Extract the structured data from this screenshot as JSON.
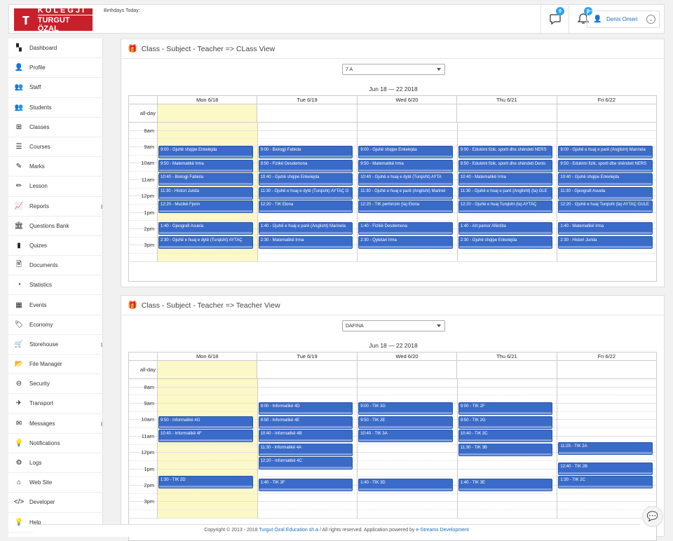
{
  "header": {
    "logo_top": "KOLEGJI",
    "logo_bottom": "TURGUT ÖZAL",
    "birthdays_label": "Birthdays Today:",
    "messages_badge": "0",
    "notifications_badge": "0",
    "user_name": "Denis Omeri"
  },
  "sidebar": {
    "items": [
      {
        "label": "Dashboard",
        "icon": "dashboard-icon",
        "glyph": "▚"
      },
      {
        "label": "Profile",
        "icon": "user-icon",
        "glyph": "👤"
      },
      {
        "label": "Staff",
        "icon": "staff-icon",
        "glyph": "👥"
      },
      {
        "label": "Students",
        "icon": "students-icon",
        "glyph": "👥"
      },
      {
        "label": "Classes",
        "icon": "classes-icon",
        "glyph": "⊞"
      },
      {
        "label": "Courses",
        "icon": "courses-icon",
        "glyph": "☰"
      },
      {
        "label": "Marks",
        "icon": "marks-icon",
        "glyph": "✎"
      },
      {
        "label": "Lesson",
        "icon": "lesson-icon",
        "glyph": "✏"
      },
      {
        "label": "Reports",
        "icon": "reports-icon",
        "glyph": "📈"
      },
      {
        "label": "Questions Bank",
        "icon": "bank-icon",
        "glyph": "🏛"
      },
      {
        "label": "Quizes",
        "icon": "quiz-icon",
        "glyph": "▮"
      },
      {
        "label": "Documents",
        "icon": "documents-icon",
        "glyph": "🖹"
      },
      {
        "label": "Statistics",
        "icon": "statistics-icon",
        "glyph": "◔"
      },
      {
        "label": "Events",
        "icon": "events-icon",
        "glyph": "▦"
      },
      {
        "label": "Economy",
        "icon": "economy-icon",
        "glyph": "🏷"
      },
      {
        "label": "Storehouse",
        "icon": "cart-icon",
        "glyph": "🛒"
      },
      {
        "label": "File Manager",
        "icon": "folder-icon",
        "glyph": "📂"
      },
      {
        "label": "Security",
        "icon": "security-icon",
        "glyph": "⊖"
      },
      {
        "label": "Transport",
        "icon": "plane-icon",
        "glyph": "✈"
      },
      {
        "label": "Messages",
        "icon": "envelope-icon",
        "glyph": "✉"
      },
      {
        "label": "Notifications",
        "icon": "bulb-icon",
        "glyph": "💡"
      },
      {
        "label": "Logs",
        "icon": "logs-icon",
        "glyph": "⚙"
      },
      {
        "label": "Web Site",
        "icon": "home-icon",
        "glyph": "⌂"
      },
      {
        "label": "Developer",
        "icon": "code-icon",
        "glyph": "</>"
      },
      {
        "label": "Help",
        "icon": "help-icon",
        "glyph": "💡"
      }
    ]
  },
  "calendar_common": {
    "days": [
      "Mon 6/18",
      "Tue 6/19",
      "Wed 6/20",
      "Thu 6/21",
      "Fri 6/22"
    ],
    "allday_label": "all-day",
    "hours": [
      "8am",
      "9am",
      "10am",
      "11am",
      "12pm",
      "1pm",
      "2pm",
      "3pm"
    ],
    "range": "Jun 18 — 22 2018"
  },
  "class_view": {
    "title": "Class - Subject - Teacher => CLass View",
    "select_value": "7 A",
    "events": [
      {
        "day": 0,
        "start": 9.0,
        "text": "9:00 - Gjuhë shqipe Enkelejda"
      },
      {
        "day": 0,
        "start": 9.833,
        "text": "9:50 - Matematikë Irma"
      },
      {
        "day": 0,
        "start": 10.667,
        "text": "10:40 - Biologji Fabiola"
      },
      {
        "day": 0,
        "start": 11.5,
        "text": "11:30 - Histori Jurida"
      },
      {
        "day": 0,
        "start": 12.333,
        "text": "12:20 - Muzikë Fjorin"
      },
      {
        "day": 0,
        "start": 13.667,
        "text": "1:40 - Gjeografi Asuela"
      },
      {
        "day": 0,
        "start": 14.5,
        "text": "2:30 - Gjuhë e huaj e dytë (Turqisht) AYTAÇ"
      },
      {
        "day": 1,
        "start": 9.0,
        "text": "9:00 - Biologji Fabiola"
      },
      {
        "day": 1,
        "start": 9.833,
        "text": "9:50 - Fizikë Desdemona"
      },
      {
        "day": 1,
        "start": 10.667,
        "text": "10:40 - Gjuhë shqipe Enkelejda"
      },
      {
        "day": 1,
        "start": 11.5,
        "text": "11:30 - Gjuhë e huaj e dytë (Turqisht) AYTAÇ G"
      },
      {
        "day": 1,
        "start": 12.333,
        "text": "12:20 - TIK Elona"
      },
      {
        "day": 1,
        "start": 13.667,
        "text": "1:40 - Gjuhë e huaj e parë (Anglisht) Marinela"
      },
      {
        "day": 1,
        "start": 14.5,
        "text": "2:30 - Matematikë Irma"
      },
      {
        "day": 2,
        "start": 9.0,
        "text": "9:00 - Gjuhë shqipe Enkelejda"
      },
      {
        "day": 2,
        "start": 9.833,
        "text": "9:50 - Matematikë Irma"
      },
      {
        "day": 2,
        "start": 10.667,
        "text": "10:40 - Gjuhë e huaj e dytë (Turqisht) AYTA"
      },
      {
        "day": 2,
        "start": 11.5,
        "text": "11:30 - Gjuhë e huaj e parë (Anglisht) Marinel"
      },
      {
        "day": 2,
        "start": 12.333,
        "text": "12:20 - TIK perforcim (ta) Elona"
      },
      {
        "day": 2,
        "start": 13.667,
        "text": "1:40 - Fizikë Desdemona"
      },
      {
        "day": 2,
        "start": 14.5,
        "text": "2:30 - Qytetari Irma"
      },
      {
        "day": 3,
        "start": 9.0,
        "text": "9:00 - Edukimi fizik, sporti dhe shëndeti NERS"
      },
      {
        "day": 3,
        "start": 9.833,
        "text": "9:50 - Edukimi fizik, sporti dhe shëndeti Denis"
      },
      {
        "day": 3,
        "start": 10.667,
        "text": "10:40 - Matematikë Irma"
      },
      {
        "day": 3,
        "start": 11.5,
        "text": "11:30 - Gjuhë e huaj e parë (Anglisht) (ta) GLE"
      },
      {
        "day": 3,
        "start": 12.333,
        "text": "12:20 - Gjuhë e huaj Turqisht (ta) AYTAÇ"
      },
      {
        "day": 3,
        "start": 13.667,
        "text": "1:40 - Art pamor Afërdita"
      },
      {
        "day": 3,
        "start": 14.5,
        "text": "2:30 - Gjuhë shqipe Enkelejda"
      },
      {
        "day": 4,
        "start": 9.0,
        "text": "9:00 - Gjuhë e huaj e parë (Anglisht) Marinela"
      },
      {
        "day": 4,
        "start": 9.833,
        "text": "9:50 - Edukimi fizik, sporti dhe shëndeti NERS"
      },
      {
        "day": 4,
        "start": 10.667,
        "text": "10:40 - Gjuhë shqipe Enkelejda"
      },
      {
        "day": 4,
        "start": 11.5,
        "text": "11:30 - Gjeografi Asuela"
      },
      {
        "day": 4,
        "start": 12.333,
        "text": "12:20 - Gjuhë e huaj Turqisht (ta) AYTAÇ GULE"
      },
      {
        "day": 4,
        "start": 13.667,
        "text": "1:40 - Matematikë Irma"
      },
      {
        "day": 4,
        "start": 14.5,
        "text": "2:30 - Histori Jurida"
      }
    ]
  },
  "teacher_view": {
    "title": "Class - Subject - Teacher => Teacher View",
    "select_value": "DAFINA",
    "events": [
      {
        "day": 0,
        "start": 9.833,
        "text": "9:50 - Informatikë 4G"
      },
      {
        "day": 0,
        "start": 10.667,
        "text": "10:40 - Informatikë 4F"
      },
      {
        "day": 0,
        "start": 13.5,
        "text": "1:30 - TIK 2D"
      },
      {
        "day": 1,
        "start": 9.0,
        "text": "9:00 - Informatikë 4D"
      },
      {
        "day": 1,
        "start": 9.833,
        "text": "9:50 - Informatikë 4E"
      },
      {
        "day": 1,
        "start": 10.667,
        "text": "10:40 - Informatikë 4B"
      },
      {
        "day": 1,
        "start": 11.5,
        "text": "11:30 - Informatikë 4A"
      },
      {
        "day": 1,
        "start": 12.333,
        "text": "12:20 - Informatikë 4C"
      },
      {
        "day": 1,
        "start": 13.667,
        "text": "1:40 - TIK 3F"
      },
      {
        "day": 2,
        "start": 9.0,
        "text": "9:00 - TIK 3G"
      },
      {
        "day": 2,
        "start": 9.833,
        "text": "9:50 - TIK 2E"
      },
      {
        "day": 2,
        "start": 10.667,
        "text": "10:40 - TIK 3A"
      },
      {
        "day": 2,
        "start": 13.667,
        "text": "1:40 - TIK 3D"
      },
      {
        "day": 3,
        "start": 9.0,
        "text": "9:00 - TIK 2F"
      },
      {
        "day": 3,
        "start": 9.833,
        "text": "9:50 - TIK 2G"
      },
      {
        "day": 3,
        "start": 10.667,
        "text": "10:40 - TIK 3C"
      },
      {
        "day": 3,
        "start": 11.5,
        "text": "11:30 - TIK 3B"
      },
      {
        "day": 3,
        "start": 13.667,
        "text": "1:40 - TIK 3E"
      },
      {
        "day": 4,
        "start": 11.417,
        "text": "11:25 - TIK 2A"
      },
      {
        "day": 4,
        "start": 12.667,
        "text": "12:40 - TIK 2B"
      },
      {
        "day": 4,
        "start": 13.5,
        "text": "1:30 - TIK 2C"
      }
    ]
  },
  "footer": {
    "prefix": "Copyright © 2013 - 2018",
    "company": "Turgut Özal Education sh.a",
    "middle": "/ All rights reserved. Application powered by",
    "powered": "e-Streams Development"
  }
}
